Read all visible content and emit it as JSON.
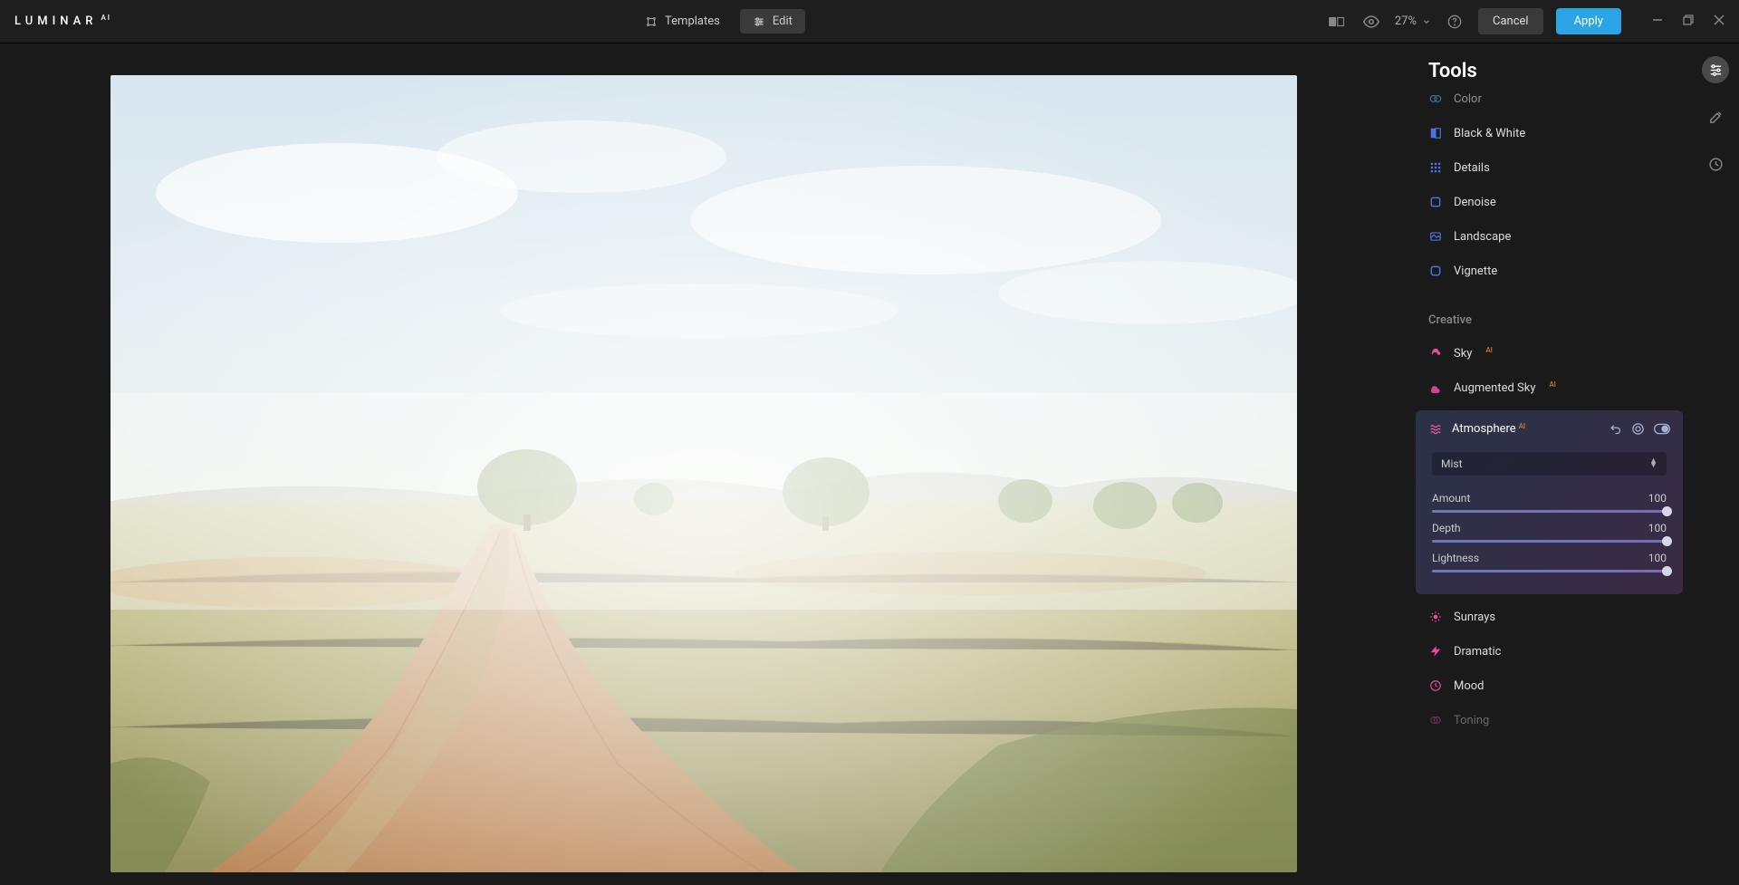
{
  "brand": {
    "name": "LUMINAR",
    "suffix": "AI"
  },
  "topbar": {
    "templates_label": "Templates",
    "edit_label": "Edit",
    "zoom": "27%",
    "cancel_label": "Cancel",
    "apply_label": "Apply"
  },
  "panel": {
    "title": "Tools",
    "essentials": [
      {
        "label": "Color",
        "color": "#4aa4e0"
      },
      {
        "label": "Black & White",
        "color": "#4a74e0"
      },
      {
        "label": "Details",
        "color": "#4a74e0"
      },
      {
        "label": "Denoise",
        "color": "#4a74e0"
      },
      {
        "label": "Landscape",
        "color": "#4a74e0"
      },
      {
        "label": "Vignette",
        "color": "#4a74e0"
      }
    ],
    "creative_label": "Creative",
    "creative": [
      {
        "label": "Sky",
        "ai": true,
        "color": "#e84aa0"
      },
      {
        "label": "Augmented Sky",
        "ai": true,
        "color": "#e84aa0"
      }
    ],
    "atmosphere": {
      "label": "Atmosphere",
      "ai": true,
      "preset": "Mist",
      "sliders": [
        {
          "name": "Amount",
          "value": "100"
        },
        {
          "name": "Depth",
          "value": "100"
        },
        {
          "name": "Lightness",
          "value": "100"
        }
      ]
    },
    "creative_below": [
      {
        "label": "Sunrays",
        "color": "#e84aa0"
      },
      {
        "label": "Dramatic",
        "color": "#e84aa0"
      },
      {
        "label": "Mood",
        "color": "#e84aa0"
      },
      {
        "label": "Toning",
        "color": "#e84aa0"
      }
    ]
  }
}
